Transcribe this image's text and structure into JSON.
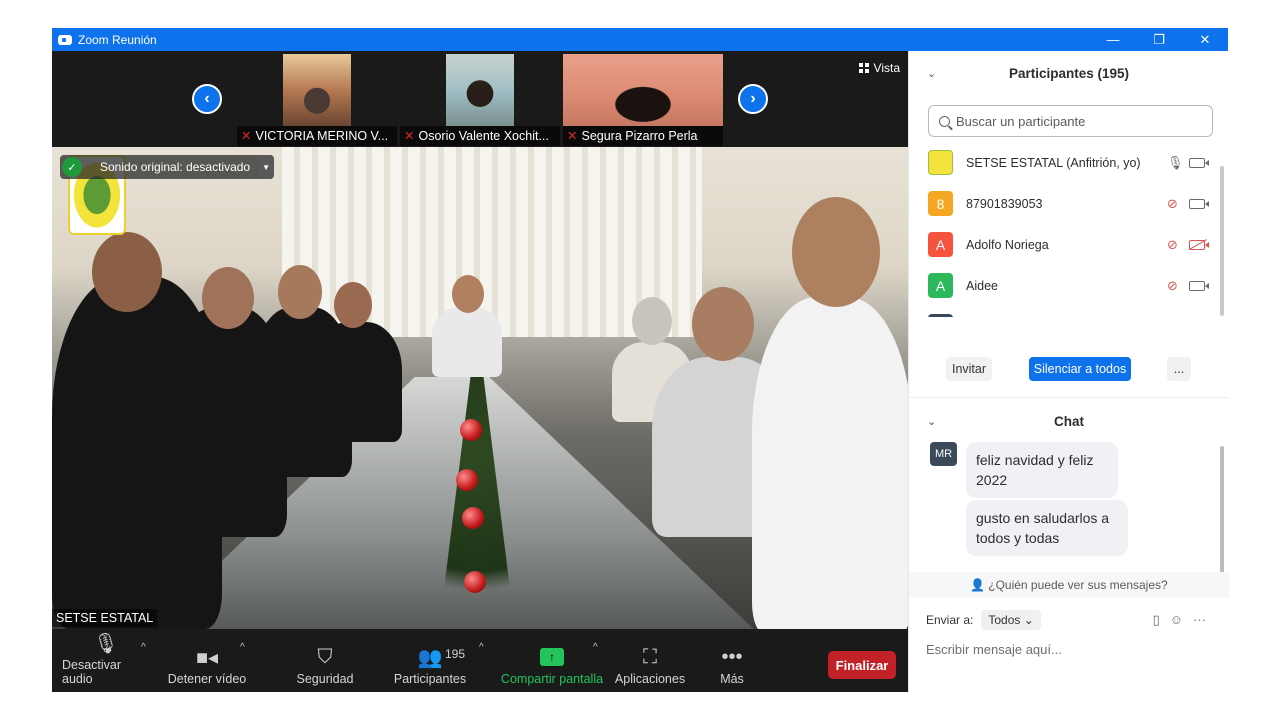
{
  "window": {
    "title": "Zoom Reunión",
    "controls": [
      "—",
      "❐",
      "✕"
    ]
  },
  "strip": {
    "thumbnails": [
      {
        "name": "VICTORIA MERINO V..."
      },
      {
        "name": "Osorio Valente Xochit..."
      },
      {
        "name": "Segura Pizarro Perla"
      }
    ],
    "vista_label": "Vista"
  },
  "main_video": {
    "sound_badge": "Sonido original: desactivado",
    "speaker_name": "SETSE ESTATAL"
  },
  "toolbar": {
    "audio": "Desactivar audio",
    "video": "Detener vídeo",
    "security": "Seguridad",
    "participants": "Participantes",
    "participants_count": "195",
    "share": "Compartir pantalla",
    "apps": "Aplicaciones",
    "more": "Más",
    "end": "Finalizar"
  },
  "participants_panel": {
    "title": "Participantes (195)",
    "search_placeholder": "Buscar un participante",
    "items": [
      {
        "name": "SETSE ESTATAL (Anfitrión, yo)",
        "avatar": "",
        "color": "#f4e23e",
        "mic": "on",
        "cam": "on"
      },
      {
        "name": "87901839053",
        "avatar": "8",
        "color": "#f5a623",
        "mic": "muted",
        "cam": "on"
      },
      {
        "name": "Adolfo Noriega",
        "avatar": "A",
        "color": "#f5533d",
        "mic": "muted",
        "cam": "off"
      },
      {
        "name": "Aidee",
        "avatar": "A",
        "color": "#2eb85c",
        "mic": "muted",
        "cam": "on"
      }
    ],
    "invite": "Invitar",
    "mute_all": "Silenciar a todos",
    "more": "..."
  },
  "chat": {
    "title": "Chat",
    "sender_initials": "MR",
    "messages": [
      "feliz navidad y feliz 2022",
      "gusto en saludarlos a todos y todas"
    ],
    "who_sees": "¿Quién puede ver sus mensajes?",
    "send_to_label": "Enviar a:",
    "send_to_value": "Todos",
    "input_placeholder": "Escribir mensaje aquí..."
  }
}
